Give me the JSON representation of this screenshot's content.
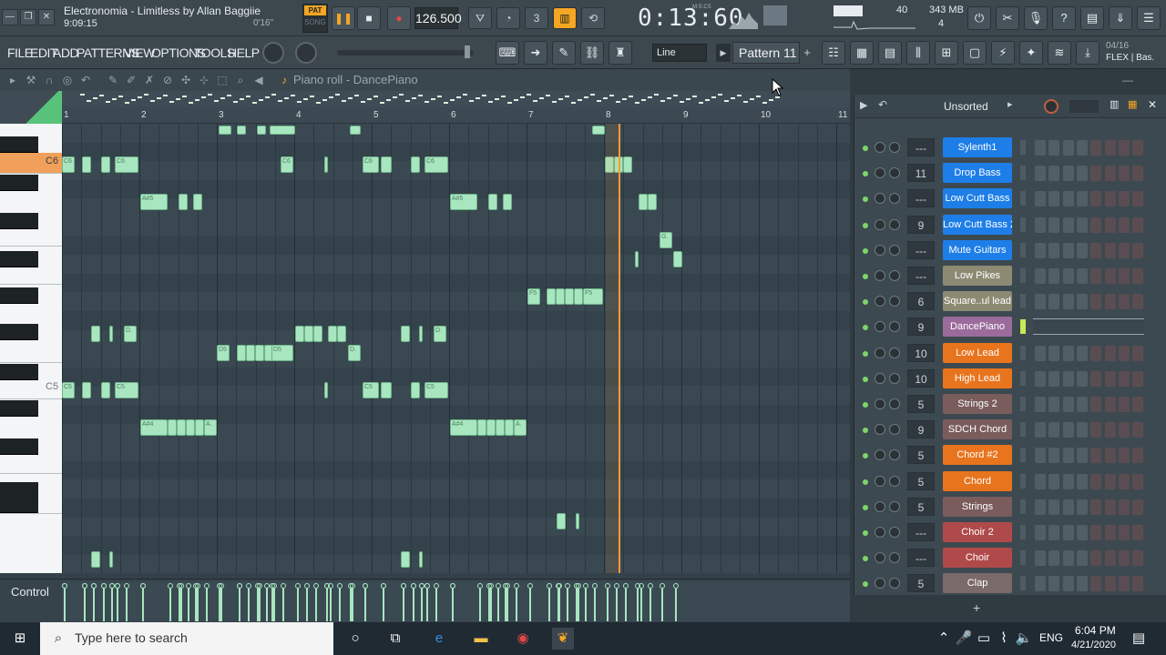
{
  "window": {
    "title": "Electronomia - Limitless by Allan Baggiie",
    "time": "9:09:15",
    "offset": "0'16\""
  },
  "transport": {
    "pat_label": "PAT",
    "song_label": "SONG",
    "tempo": "126.500",
    "clock": "0:13:60",
    "clock_mode": "M:S:CS"
  },
  "status": {
    "cpu_count": "40",
    "memory": "343 MB",
    "poly": "4"
  },
  "menu": {
    "items": [
      "FILE",
      "EDIT",
      "ADD",
      "PATTERNS",
      "VIEW",
      "OPTIONS",
      "TOOLS",
      "HELP"
    ]
  },
  "toolbar": {
    "snap": "Line",
    "pattern": "Pattern 11",
    "hint_date": "04/16",
    "hint_text": "FLEX | Bas."
  },
  "piano_roll": {
    "title": "Piano roll - DanceP​iano",
    "bars": [
      "1",
      "2",
      "3",
      "4",
      "5",
      "6",
      "7",
      "8",
      "9",
      "10",
      "11"
    ],
    "key_c6": "C6",
    "key_c5": "C5",
    "control_label": "Control"
  },
  "channel_rack": {
    "filter": "Unsorted",
    "add": "+",
    "channels": [
      {
        "mix": "---",
        "name": "Sylenth1",
        "color": "#1e7ee8"
      },
      {
        "mix": "11",
        "name": "Drop Bass",
        "color": "#1e7ee8"
      },
      {
        "mix": "---",
        "name": "Low Cutt Bass",
        "color": "#1e7ee8"
      },
      {
        "mix": "9",
        "name": "Low Cutt Bass 2",
        "color": "#1e7ee8"
      },
      {
        "mix": "---",
        "name": "Mute Guitars",
        "color": "#1e7ee8"
      },
      {
        "mix": "---",
        "name": "Low Pikes",
        "color": "#8d8a74"
      },
      {
        "mix": "6",
        "name": "Square..ul lead",
        "color": "#8d8a74"
      },
      {
        "mix": "9",
        "name": "DanceP​iano",
        "color": "#9b6b9c"
      },
      {
        "mix": "10",
        "name": "Low Lead",
        "color": "#e8741e"
      },
      {
        "mix": "10",
        "name": "High Lead",
        "color": "#e8741e"
      },
      {
        "mix": "5",
        "name": "Strings 2",
        "color": "#7a5c5c"
      },
      {
        "mix": "9",
        "name": "SDCH Chord",
        "color": "#7a5c5c"
      },
      {
        "mix": "5",
        "name": "Chord #2",
        "color": "#e8741e"
      },
      {
        "mix": "5",
        "name": "Chord",
        "color": "#e8741e"
      },
      {
        "mix": "5",
        "name": "Strings",
        "color": "#7a5c5c"
      },
      {
        "mix": "---",
        "name": "Choir 2",
        "color": "#b04a4a"
      },
      {
        "mix": "---",
        "name": "Choir",
        "color": "#b04a4a"
      },
      {
        "mix": "5",
        "name": "Clap",
        "color": "#7a6a6a"
      }
    ]
  },
  "taskbar": {
    "search_placeholder": "Type here to search",
    "time": "6:04 PM",
    "date": "4/21/2020",
    "lang": "ENG"
  }
}
